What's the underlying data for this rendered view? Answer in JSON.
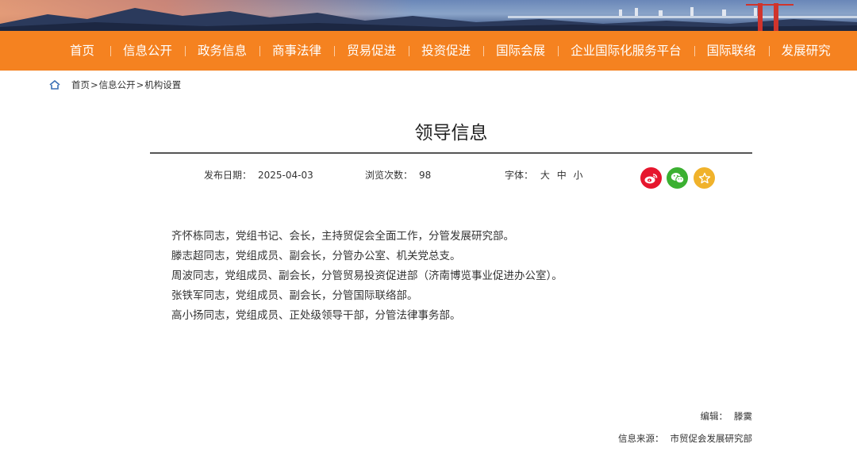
{
  "nav": {
    "items": [
      "首页",
      "信息公开",
      "政务信息",
      "商事法律",
      "贸易促进",
      "投资促进",
      "国际会展",
      "企业国际化服务平台",
      "国际联络",
      "发展研究"
    ]
  },
  "breadcrumb": {
    "items": [
      "首页",
      "信息公开",
      "机构设置"
    ],
    "separator": ">"
  },
  "article": {
    "title": "领导信息",
    "publish_label": "发布日期：",
    "publish_date": "2025-04-03",
    "views_label": "浏览次数：",
    "views": "98",
    "font_label": "字体：",
    "font_sizes": [
      "大",
      "中",
      "小"
    ],
    "paragraphs": [
      "齐怀栋同志，党组书记、会长，主持贸促会全面工作，分管发展研究部。",
      "滕志超同志，党组成员、副会长，分管办公室、机关党总支。",
      "周波同志，党组成员、副会长，分管贸易投资促进部（济南博览事业促进办公室）。",
      "张铁军同志，党组成员、副会长，分管国际联络部。",
      "高小扬同志，党组成员、正处级领导干部，分管法律事务部。"
    ],
    "editor_label": "编辑：",
    "editor": "滕霙",
    "source_label": "信息来源：",
    "source": "市贸促会发展研究部"
  },
  "share": {
    "icons": [
      "weibo-icon",
      "wechat-icon",
      "favorite-icon"
    ],
    "colors": {
      "weibo": "#e6162d",
      "wechat": "#3bb031",
      "favorite": "#f0b22b"
    }
  },
  "theme": {
    "nav_bg": "#f58220"
  }
}
